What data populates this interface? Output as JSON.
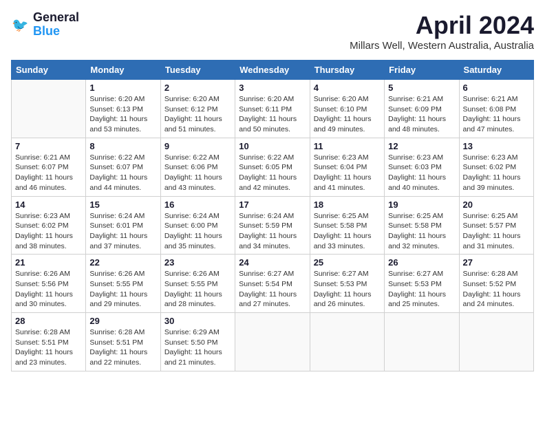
{
  "header": {
    "logo_line1": "General",
    "logo_line2": "Blue",
    "month_title": "April 2024",
    "location": "Millars Well, Western Australia, Australia"
  },
  "days_of_week": [
    "Sunday",
    "Monday",
    "Tuesday",
    "Wednesday",
    "Thursday",
    "Friday",
    "Saturday"
  ],
  "weeks": [
    [
      {
        "day": "",
        "info": ""
      },
      {
        "day": "1",
        "info": "Sunrise: 6:20 AM\nSunset: 6:13 PM\nDaylight: 11 hours\nand 53 minutes."
      },
      {
        "day": "2",
        "info": "Sunrise: 6:20 AM\nSunset: 6:12 PM\nDaylight: 11 hours\nand 51 minutes."
      },
      {
        "day": "3",
        "info": "Sunrise: 6:20 AM\nSunset: 6:11 PM\nDaylight: 11 hours\nand 50 minutes."
      },
      {
        "day": "4",
        "info": "Sunrise: 6:20 AM\nSunset: 6:10 PM\nDaylight: 11 hours\nand 49 minutes."
      },
      {
        "day": "5",
        "info": "Sunrise: 6:21 AM\nSunset: 6:09 PM\nDaylight: 11 hours\nand 48 minutes."
      },
      {
        "day": "6",
        "info": "Sunrise: 6:21 AM\nSunset: 6:08 PM\nDaylight: 11 hours\nand 47 minutes."
      }
    ],
    [
      {
        "day": "7",
        "info": "Sunrise: 6:21 AM\nSunset: 6:07 PM\nDaylight: 11 hours\nand 46 minutes."
      },
      {
        "day": "8",
        "info": "Sunrise: 6:22 AM\nSunset: 6:07 PM\nDaylight: 11 hours\nand 44 minutes."
      },
      {
        "day": "9",
        "info": "Sunrise: 6:22 AM\nSunset: 6:06 PM\nDaylight: 11 hours\nand 43 minutes."
      },
      {
        "day": "10",
        "info": "Sunrise: 6:22 AM\nSunset: 6:05 PM\nDaylight: 11 hours\nand 42 minutes."
      },
      {
        "day": "11",
        "info": "Sunrise: 6:23 AM\nSunset: 6:04 PM\nDaylight: 11 hours\nand 41 minutes."
      },
      {
        "day": "12",
        "info": "Sunrise: 6:23 AM\nSunset: 6:03 PM\nDaylight: 11 hours\nand 40 minutes."
      },
      {
        "day": "13",
        "info": "Sunrise: 6:23 AM\nSunset: 6:02 PM\nDaylight: 11 hours\nand 39 minutes."
      }
    ],
    [
      {
        "day": "14",
        "info": "Sunrise: 6:23 AM\nSunset: 6:02 PM\nDaylight: 11 hours\nand 38 minutes."
      },
      {
        "day": "15",
        "info": "Sunrise: 6:24 AM\nSunset: 6:01 PM\nDaylight: 11 hours\nand 37 minutes."
      },
      {
        "day": "16",
        "info": "Sunrise: 6:24 AM\nSunset: 6:00 PM\nDaylight: 11 hours\nand 35 minutes."
      },
      {
        "day": "17",
        "info": "Sunrise: 6:24 AM\nSunset: 5:59 PM\nDaylight: 11 hours\nand 34 minutes."
      },
      {
        "day": "18",
        "info": "Sunrise: 6:25 AM\nSunset: 5:58 PM\nDaylight: 11 hours\nand 33 minutes."
      },
      {
        "day": "19",
        "info": "Sunrise: 6:25 AM\nSunset: 5:58 PM\nDaylight: 11 hours\nand 32 minutes."
      },
      {
        "day": "20",
        "info": "Sunrise: 6:25 AM\nSunset: 5:57 PM\nDaylight: 11 hours\nand 31 minutes."
      }
    ],
    [
      {
        "day": "21",
        "info": "Sunrise: 6:26 AM\nSunset: 5:56 PM\nDaylight: 11 hours\nand 30 minutes."
      },
      {
        "day": "22",
        "info": "Sunrise: 6:26 AM\nSunset: 5:55 PM\nDaylight: 11 hours\nand 29 minutes."
      },
      {
        "day": "23",
        "info": "Sunrise: 6:26 AM\nSunset: 5:55 PM\nDaylight: 11 hours\nand 28 minutes."
      },
      {
        "day": "24",
        "info": "Sunrise: 6:27 AM\nSunset: 5:54 PM\nDaylight: 11 hours\nand 27 minutes."
      },
      {
        "day": "25",
        "info": "Sunrise: 6:27 AM\nSunset: 5:53 PM\nDaylight: 11 hours\nand 26 minutes."
      },
      {
        "day": "26",
        "info": "Sunrise: 6:27 AM\nSunset: 5:53 PM\nDaylight: 11 hours\nand 25 minutes."
      },
      {
        "day": "27",
        "info": "Sunrise: 6:28 AM\nSunset: 5:52 PM\nDaylight: 11 hours\nand 24 minutes."
      }
    ],
    [
      {
        "day": "28",
        "info": "Sunrise: 6:28 AM\nSunset: 5:51 PM\nDaylight: 11 hours\nand 23 minutes."
      },
      {
        "day": "29",
        "info": "Sunrise: 6:28 AM\nSunset: 5:51 PM\nDaylight: 11 hours\nand 22 minutes."
      },
      {
        "day": "30",
        "info": "Sunrise: 6:29 AM\nSunset: 5:50 PM\nDaylight: 11 hours\nand 21 minutes."
      },
      {
        "day": "",
        "info": ""
      },
      {
        "day": "",
        "info": ""
      },
      {
        "day": "",
        "info": ""
      },
      {
        "day": "",
        "info": ""
      }
    ]
  ]
}
